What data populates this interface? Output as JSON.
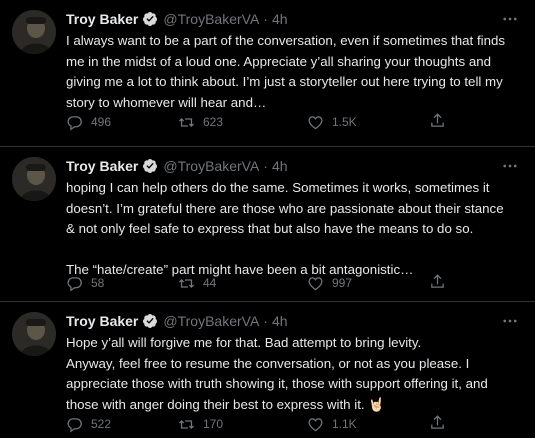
{
  "colors": {
    "background": "#000000",
    "divider": "#2f3336",
    "muted": "#71767b",
    "text": "#e7e9ea",
    "verified": "#1d9bf0"
  },
  "tweets": [
    {
      "name": "Troy Baker",
      "handle": "@TroyBakerVA",
      "separator": "·",
      "time": "4h",
      "verified": true,
      "text": "I always want to be a part of the conversation, even if sometimes that finds\nme in the midst of a loud one. Appreciate y’all sharing your thoughts and\ngiving me a lot to think about. I’m just a storyteller out here trying to tell my\nstory to whomever will hear and…",
      "replies": "496",
      "retweets": "623",
      "likes": "1.5K"
    },
    {
      "name": "Troy Baker",
      "handle": "@TroyBakerVA",
      "separator": "·",
      "time": "4h",
      "verified": true,
      "text": "hoping I can help others do the same. Sometimes it works, sometimes it\ndoesn’t. I’m grateful there are those who are passionate about their stance\n& not only feel safe to express that but also have the means to do so.\n\nThe “hate/create” part might have been a bit antagonistic…",
      "replies": "58",
      "retweets": "44",
      "likes": "997"
    },
    {
      "name": "Troy Baker",
      "handle": "@TroyBakerVA",
      "separator": "·",
      "time": "4h",
      "verified": true,
      "text": "Hope y’all will forgive me for that. Bad attempt to bring levity.\nAnyway, feel free to resume the conversation, or not as you please. I\nappreciate those with truth showing it, those with support offering it, and\nthose with anger doing their best to express with it. 🤘🏻",
      "replies": "522",
      "retweets": "170",
      "likes": "1.1K"
    }
  ],
  "icons": {
    "avatar": "profile-photo",
    "verified": "verified-badge-icon",
    "more": "more-options-icon",
    "reply": "reply-icon",
    "retweet": "retweet-icon",
    "like": "heart-icon",
    "share": "share-icon"
  }
}
